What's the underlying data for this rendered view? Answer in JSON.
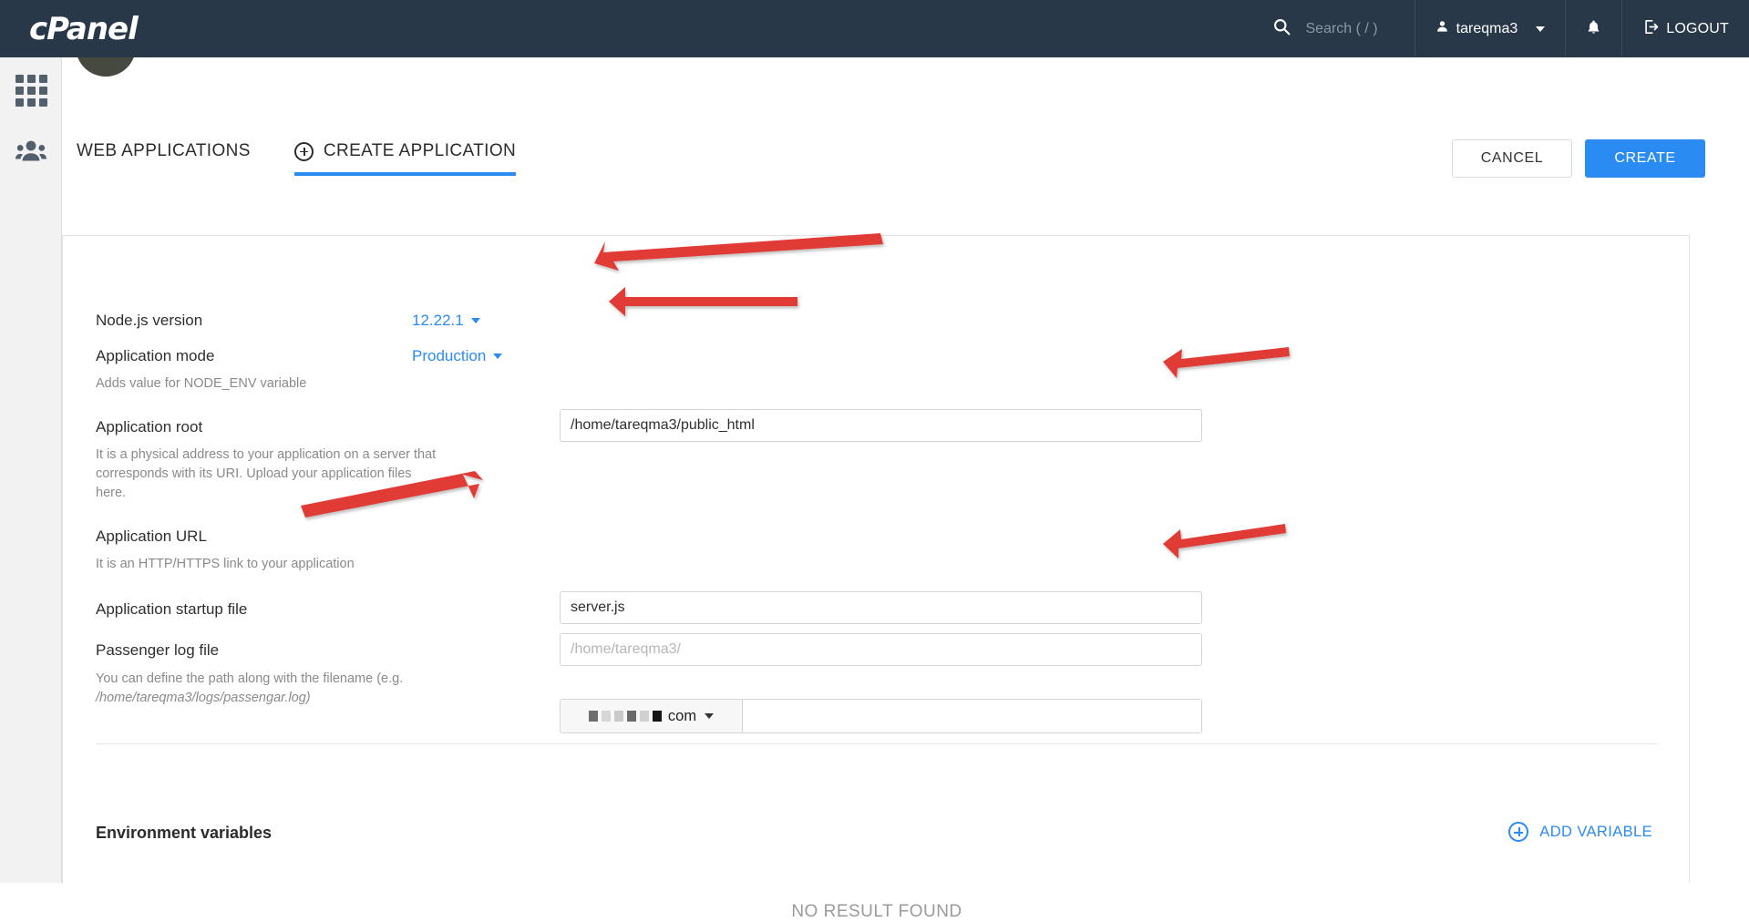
{
  "header": {
    "logo_text": "cPanel",
    "search": {
      "icon": "search-icon",
      "placeholder": "Search ( / )"
    },
    "user": {
      "icon": "user-icon",
      "name": "tareqma3",
      "caret": "chevron-down-icon"
    },
    "notifications_icon": "bell-icon",
    "logout": {
      "icon": "logout-icon",
      "label": "LOGOUT"
    }
  },
  "sidebar": {
    "items": [
      {
        "icon": "grid-apps-icon",
        "name": "apps"
      },
      {
        "icon": "users-icon",
        "name": "users"
      }
    ]
  },
  "tabs": [
    {
      "label": "WEB APPLICATIONS",
      "active": false
    },
    {
      "label": "CREATE APPLICATION",
      "active": true,
      "icon": "plus-circle-icon"
    }
  ],
  "toolbar": {
    "cancel_label": "CANCEL",
    "create_label": "CREATE"
  },
  "form": {
    "node_version": {
      "label": "Node.js version",
      "value": "12.22.1"
    },
    "app_mode": {
      "label": "Application mode",
      "value": "Production",
      "hint": "Adds value for NODE_ENV variable"
    },
    "app_root": {
      "label": "Application root",
      "value": "/home/tareqma3/public_html",
      "hint": "It is a physical address to your application on a server that corresponds with its URI. Upload your application files here."
    },
    "app_url": {
      "label": "Application URL",
      "hint": "It is an HTTP/HTTPS link to your application",
      "domain_tld": "com",
      "domain_redacted": true,
      "path_value": ""
    },
    "startup_file": {
      "label": "Application startup file",
      "value": "server.js"
    },
    "passenger_log": {
      "label": "Passenger log file",
      "value": "",
      "placeholder": "/home/tareqma3/",
      "hint_plain": "You can define the path along with the filename (e.g.",
      "hint_italic": "/home/tareqma3/logs/passengar.log)"
    }
  },
  "env_section": {
    "title": "Environment variables",
    "add_label": "ADD VARIABLE",
    "empty_message": "NO RESULT FOUND"
  },
  "colors": {
    "header_bg": "#283848",
    "accent_blue": "#2a8bf2",
    "annotation_red": "#e03a36",
    "rail_bg": "#f2f2f2"
  },
  "annotations": {
    "arrow_count": 5,
    "targets": [
      "node-version",
      "application-mode",
      "application-root",
      "application-url",
      "startup-file"
    ]
  }
}
